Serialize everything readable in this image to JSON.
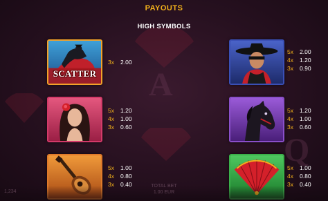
{
  "header": {
    "title": "PAYOUTS",
    "section": "HIGH SYMBOLS"
  },
  "symbols": [
    {
      "id": "scatter",
      "icon": "scatter-rider-icon",
      "label": "SCATTER",
      "border_color": "#f2a12a",
      "payouts": [
        {
          "count": "3x",
          "amount": "2.00"
        }
      ]
    },
    {
      "id": "zorro",
      "icon": "masked-hero-icon",
      "border_color": "#3a4fb5",
      "payouts": [
        {
          "count": "5x",
          "amount": "2.00"
        },
        {
          "count": "4x",
          "amount": "1.20"
        },
        {
          "count": "3x",
          "amount": "0.90"
        }
      ]
    },
    {
      "id": "lady",
      "icon": "flamenco-lady-icon",
      "border_color": "#d43a6a",
      "payouts": [
        {
          "count": "5x",
          "amount": "1.20"
        },
        {
          "count": "4x",
          "amount": "1.00"
        },
        {
          "count": "3x",
          "amount": "0.60"
        }
      ]
    },
    {
      "id": "horse",
      "icon": "black-horse-icon",
      "border_color": "#8a4fc9",
      "payouts": [
        {
          "count": "5x",
          "amount": "1.20"
        },
        {
          "count": "4x",
          "amount": "1.00"
        },
        {
          "count": "3x",
          "amount": "0.60"
        }
      ]
    },
    {
      "id": "guitar",
      "icon": "guitar-icon",
      "border_color": "#e07a2a",
      "payouts": [
        {
          "count": "5x",
          "amount": "1.00"
        },
        {
          "count": "4x",
          "amount": "0.80"
        },
        {
          "count": "3x",
          "amount": "0.40"
        }
      ]
    },
    {
      "id": "fan",
      "icon": "hand-fan-icon",
      "border_color": "#3bb04a",
      "payouts": [
        {
          "count": "5x",
          "amount": "1.00"
        },
        {
          "count": "4x",
          "amount": "0.80"
        },
        {
          "count": "3x",
          "amount": "0.40"
        }
      ]
    }
  ],
  "footer": {
    "total_bet_label": "TOTAL BET",
    "total_bet_value": "1.00 EUR",
    "balance_partial": "1,234"
  },
  "colors": {
    "title": "#f4b21b",
    "multiplier": "#f4b21b",
    "background": "#26101f"
  }
}
